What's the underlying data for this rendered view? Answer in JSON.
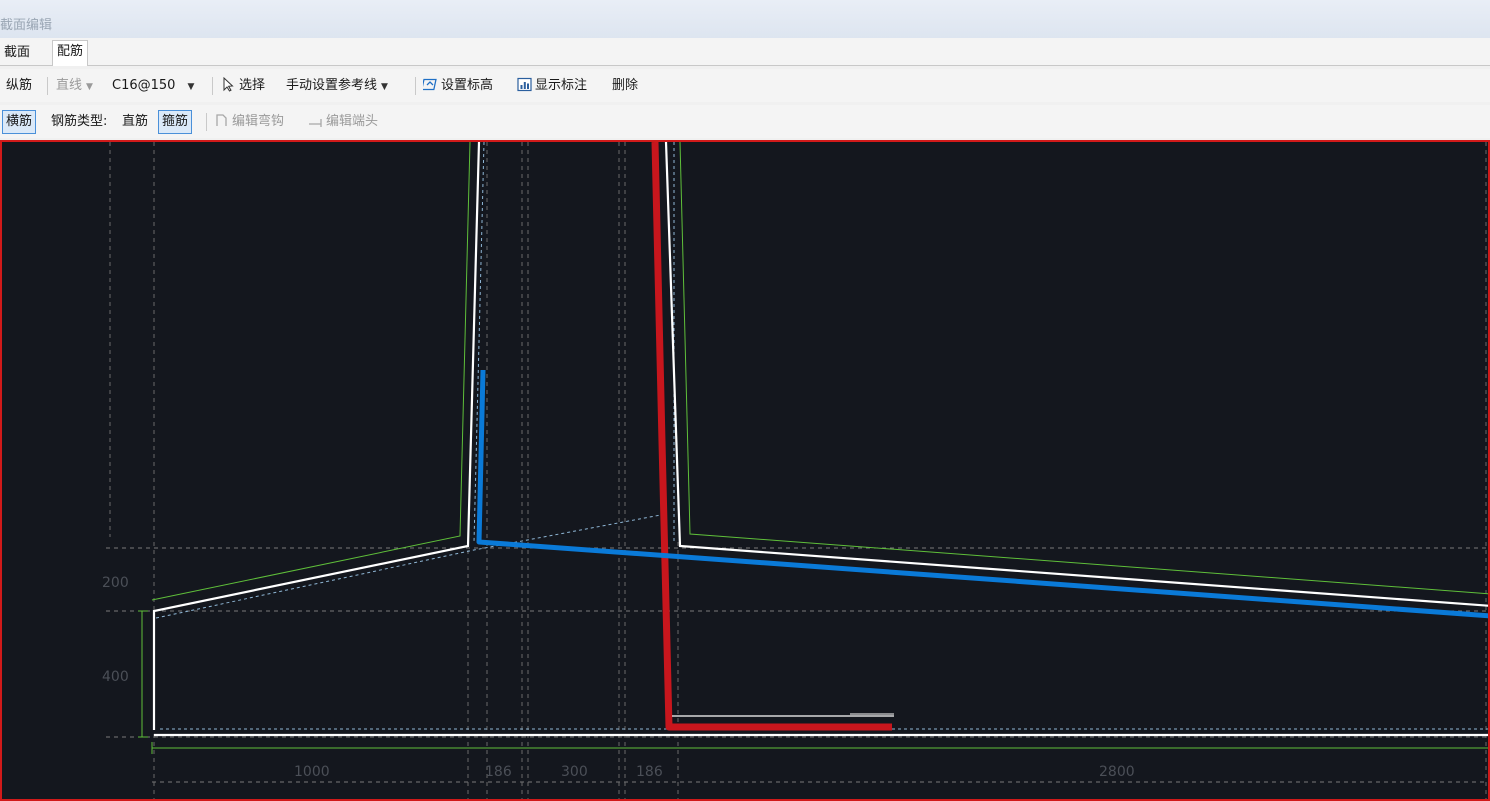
{
  "window": {
    "title": "截面编辑"
  },
  "tabs": [
    {
      "label": "截面",
      "active": false
    },
    {
      "label": "配筋",
      "active": true
    }
  ],
  "toolbar1": {
    "longitudinal": "纵筋",
    "line_mode": "直线",
    "rebar_spec": "C16@150",
    "select": "选择",
    "manual_ref_line": "手动设置参考线",
    "set_elevation": "设置标高",
    "show_dimensions": "显示标注",
    "delete": "删除"
  },
  "toolbar2": {
    "transverse": "横筋",
    "rebar_type_label": "钢筋类型:",
    "straight_bar": "直筋",
    "stirrup": "箍筋",
    "edit_hook": "编辑弯钩",
    "edit_end": "编辑端头"
  },
  "drawing": {
    "dim_left_upper": "200",
    "dim_left_lower": "400",
    "bottom_dims": [
      "1000",
      "186",
      "300",
      "186",
      "2800"
    ],
    "colors": {
      "background": "#14171e",
      "outline": "#ffffff",
      "green_dim": "#5fbf3a",
      "blue_rebar": "#0a7ad8",
      "red_rebar": "#c8161d",
      "dashed": "#8fb7d6",
      "frame": "#d11a1a"
    }
  }
}
